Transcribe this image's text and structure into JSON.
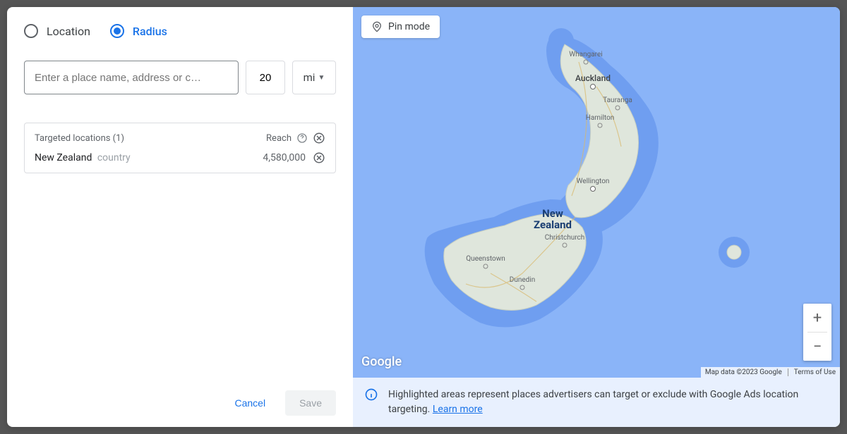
{
  "radio": {
    "location_label": "Location",
    "radius_label": "Radius",
    "selected": "radius"
  },
  "search": {
    "placeholder": "Enter a place name, address or c…",
    "radius_value": "20",
    "unit": "mi"
  },
  "targeted": {
    "header": "Targeted locations (1)",
    "reach_label": "Reach",
    "items": [
      {
        "name": "New Zealand",
        "type": "country",
        "reach": "4,580,000"
      }
    ]
  },
  "buttons": {
    "cancel": "Cancel",
    "save": "Save"
  },
  "map": {
    "pin_mode": "Pin mode",
    "logo": "Google",
    "credits_data": "Map data ©2023 Google",
    "credits_terms": "Terms of Use",
    "country_name_line1": "New",
    "country_name_line2": "Zealand",
    "cities": {
      "whangarei": "Whangarei",
      "auckland": "Auckland",
      "tauranga": "Tauranga",
      "hamilton": "Hamilton",
      "wellington": "Wellington",
      "christchurch": "Christchurch",
      "queenstown": "Queenstown",
      "dunedin": "Dunedin"
    }
  },
  "info": {
    "text": "Highlighted areas represent places advertisers can target or exclude with Google Ads location targeting.",
    "learn_more": "Learn more"
  }
}
